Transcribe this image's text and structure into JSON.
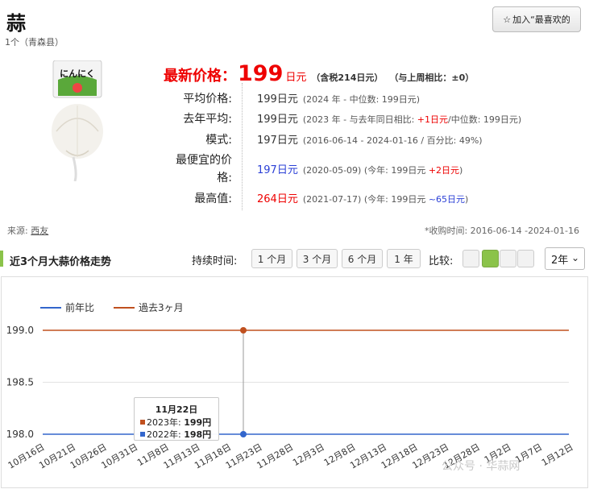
{
  "product": {
    "title": "蒜",
    "subtitle": "1个（青森县）",
    "image_alt": "にんにく",
    "image_label": "にんにく"
  },
  "favorite_button": {
    "label": "加入“最喜欢的",
    "icon": "star-icon"
  },
  "latest_price": {
    "label": "最新价格：",
    "value": "199",
    "unit": "日元",
    "tax_note": "（含税214日元）",
    "week_change": "（与上周相比：±0）"
  },
  "stats": [
    {
      "label": "平均价格:",
      "value": "199日元",
      "note": "(2024 年 - 中位数: 199日元)"
    },
    {
      "label": "去年平均:",
      "value": "199日元",
      "note_prefix": "(2023 年 - 与去年同日相比: ",
      "note_highlight": "+1日元",
      "note_suffix": "/中位数: 199日元)"
    },
    {
      "label": "模式:",
      "value": "197日元",
      "note": "(2016-06-14 - 2024-01-16 / 百分比: 49%)"
    },
    {
      "label_line1": "最便宜的价",
      "label_line2": "格:",
      "value": "197日元",
      "note_prefix": "(2020-05-09) (今年: 199日元 ",
      "note_highlight": "+2日元",
      "note_suffix": ")"
    },
    {
      "label": "最高值:",
      "value": "264日元",
      "note_prefix": "(2021-07-17) (今年: 199日元 ",
      "note_highlight": "~65日元",
      "note_suffix": ")"
    }
  ],
  "source": {
    "label": "来源:",
    "link": "西友"
  },
  "collection_time": "*收购时间: 2016-06-14 -2024-01-16",
  "section": {
    "title": "近3个月大蒜价格走势",
    "duration_label": "持续时间:",
    "duration_options": [
      "1 个月",
      "3 个月",
      "6 个月",
      "1 年"
    ],
    "compare_label": "比较:",
    "year_select": "2年"
  },
  "colors": {
    "accent_green": "#8bc34a",
    "price_red": "#e00000",
    "series_blue": "#3366cc",
    "series_orange": "#c0501f"
  },
  "chart_data": {
    "type": "line",
    "x": [
      "10月16日",
      "10月21日",
      "10月26日",
      "10月31日",
      "11月8日",
      "11月13日",
      "11月18日",
      "11月23日",
      "11月28日",
      "12月3日",
      "12月8日",
      "12月13日",
      "12月18日",
      "12月23日",
      "12月28日",
      "1月2日",
      "1月7日",
      "1月12日"
    ],
    "yticks": [
      "199.0",
      "198.5",
      "198.0"
    ],
    "ylim": [
      198.0,
      199.0
    ],
    "series": [
      {
        "name": "前年比",
        "color": "#3366cc",
        "values": [
          198,
          198,
          198,
          198,
          198,
          198,
          198,
          198,
          198,
          198,
          198,
          198,
          198,
          198,
          198,
          198,
          198,
          198
        ]
      },
      {
        "name": "過去3ヶ月",
        "color": "#c0501f",
        "values": [
          199,
          199,
          199,
          199,
          199,
          199,
          199,
          199,
          199,
          199,
          199,
          199,
          199,
          199,
          199,
          199,
          199,
          199
        ]
      }
    ],
    "legend": "top-left",
    "grid": true,
    "tooltip": {
      "date": "11月22日",
      "rows": [
        {
          "label": "2023年: ",
          "value": "199円"
        },
        {
          "label": "2022年: ",
          "value": "198円"
        }
      ]
    }
  },
  "watermark": "公众号 · 华蒜网"
}
